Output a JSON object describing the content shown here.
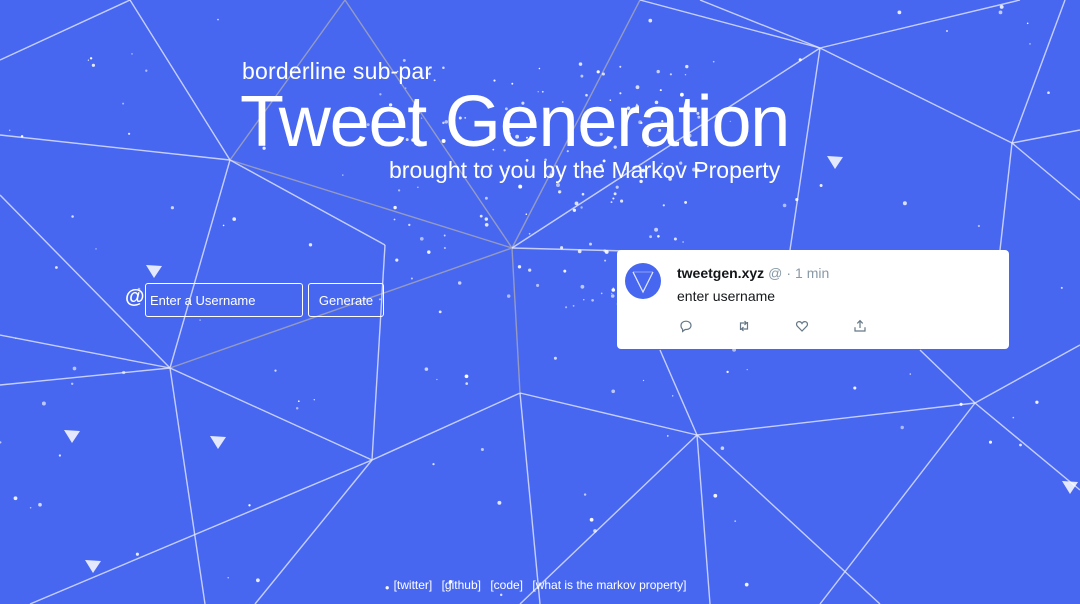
{
  "hero": {
    "kicker": "borderline sub-par",
    "title": "Tweet Generation",
    "tagline": "brought to you by the Markov Property"
  },
  "form": {
    "at_symbol": "@",
    "username_placeholder": "Enter a Username",
    "username_value": "",
    "generate_label": "Generate"
  },
  "tweet": {
    "name": "tweetgen.xyz",
    "handle": "@",
    "separator": "·",
    "time": "1 min",
    "text": "enter username",
    "avatar_icon": "tweetgen-logo-icon",
    "actions": [
      "reply-icon",
      "retweet-icon",
      "like-icon",
      "share-icon"
    ]
  },
  "footer": {
    "links": [
      "[twitter]",
      "[github]",
      "[code]",
      "[what is the markov property]"
    ]
  },
  "colors": {
    "background": "#4767f0",
    "lines_light": "#e6e9ff",
    "lines_gray": "#a7a8b8",
    "card": "#ffffff",
    "muted_text": "#8899a6"
  }
}
